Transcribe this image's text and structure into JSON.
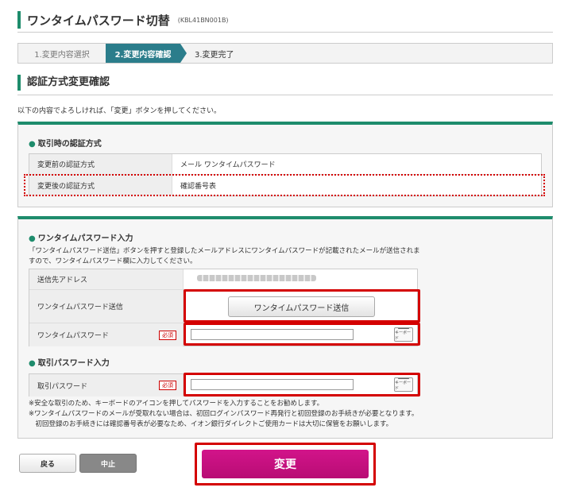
{
  "header": {
    "title": "ワンタイムパスワード切替",
    "code": "(KBL41BN001B)"
  },
  "steps": [
    {
      "label": "1.変更内容選択"
    },
    {
      "label": "2.変更内容確認"
    },
    {
      "label": "3.変更完了"
    }
  ],
  "section": {
    "title": "認証方式変更確認",
    "intro": "以下の内容でよろしければ、「変更」ボタンを押してください。"
  },
  "auth_method": {
    "heading": "取引時の認証方式",
    "rows": [
      {
        "label": "変更前の認証方式",
        "value": "メール ワンタイムパスワード"
      },
      {
        "label": "変更後の認証方式",
        "value": "確認番号表"
      }
    ]
  },
  "otp": {
    "heading": "ワンタイムパスワード入力",
    "description": "「ワンタイムパスワード送信」ボタンを押すと登録したメールアドレスにワンタイムパスワードが記載されたメールが送信されますので、ワンタイムパスワード欄に入力してください。",
    "rows": [
      {
        "label": "送信先アドレス"
      },
      {
        "label": "ワンタイムパスワード送信",
        "button": "ワンタイムパスワード送信"
      },
      {
        "label": "ワンタイムパスワード",
        "required": "必須"
      }
    ]
  },
  "txn_password": {
    "heading": "取引パスワード入力",
    "label": "取引パスワード",
    "required": "必須"
  },
  "keyboard_label": "キーボード",
  "notes": [
    "※安全な取引のため、キーボードのアイコンを押してパスワードを入力することをお勧めします。",
    "※ワンタイムパスワードのメールが受取れない場合は、初回ログインパスワード再発行と初回登録のお手続きが必要となります。",
    "　初回登録のお手続きには確認番号表が必要なため、イオン銀行ダイレクトご使用カードは大切に保管をお願いします。"
  ],
  "buttons": {
    "back": "戻る",
    "stop": "中止",
    "change": "変更"
  }
}
